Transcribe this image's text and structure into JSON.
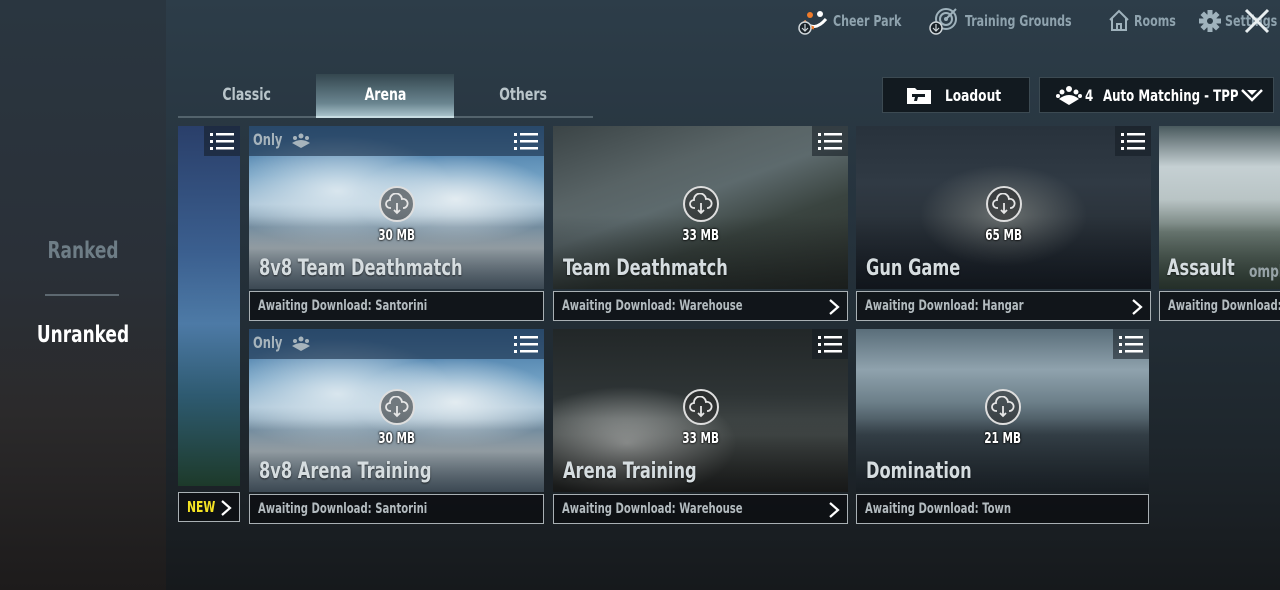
{
  "side_panel": {
    "items": [
      {
        "label": "Ranked",
        "active": false
      },
      {
        "label": "Unranked",
        "active": true
      }
    ]
  },
  "top_nav": {
    "items": [
      {
        "label": "Cheer Park",
        "icon": "cheer-park-icon"
      },
      {
        "label": "Training Grounds",
        "icon": "target-icon"
      },
      {
        "label": "Rooms",
        "icon": "home-icon"
      },
      {
        "label": "Settings",
        "icon": "gear-icon"
      }
    ],
    "close_icon": "close-icon"
  },
  "tabs": [
    {
      "label": "Classic",
      "active": false
    },
    {
      "label": "Arena",
      "active": true
    },
    {
      "label": "Others",
      "active": false
    }
  ],
  "loadout_button": {
    "label": "Loadout",
    "icon": "folder-gun-icon"
  },
  "matching_dropdown": {
    "squad_size": "4",
    "label": "Auto Matching - TPP",
    "icon": "squad-icon"
  },
  "partial_card": {
    "new_badge": "NEW"
  },
  "modes": [
    {
      "title": "8v8 Team Deathmatch",
      "size": "30 MB",
      "status": "Awaiting Download: Santorini",
      "only_tag": "Only",
      "has_arrow": false
    },
    {
      "title": "Team Deathmatch",
      "size": "33 MB",
      "status": "Awaiting Download: Warehouse",
      "only_tag": "",
      "has_arrow": true
    },
    {
      "title": "Gun Game",
      "size": "65 MB",
      "status": "Awaiting Download: Hangar",
      "only_tag": "",
      "has_arrow": true
    },
    {
      "title": "Assault",
      "subtitle": "omplex",
      "status": "Awaiting Download: I",
      "only_tag": "",
      "has_arrow": false
    },
    {
      "title": "8v8 Arena Training",
      "size": "30 MB",
      "status": "Awaiting Download: Santorini",
      "only_tag": "Only",
      "has_arrow": false
    },
    {
      "title": "Arena Training",
      "size": "33 MB",
      "status": "Awaiting Download: Warehouse",
      "only_tag": "",
      "has_arrow": true
    },
    {
      "title": "Domination",
      "size": "21 MB",
      "status": "Awaiting Download: Town",
      "only_tag": "",
      "has_arrow": false
    }
  ]
}
